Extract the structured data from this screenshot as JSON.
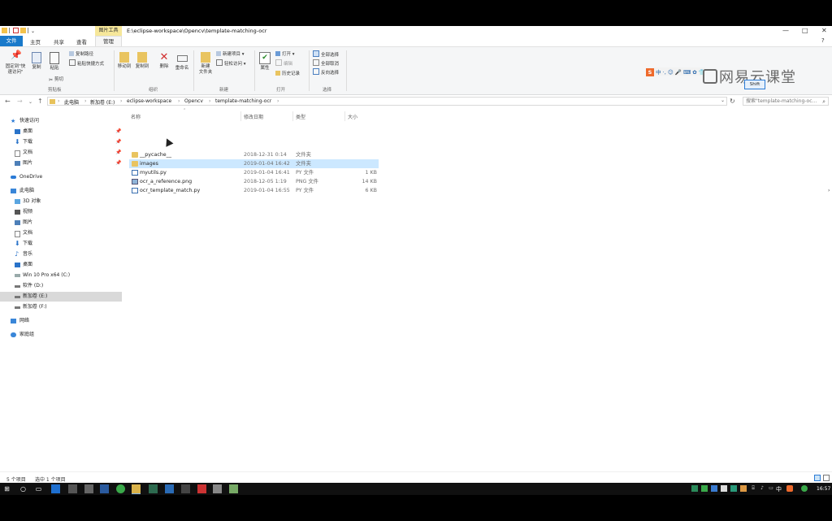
{
  "window": {
    "title": "E:\\eclipse-workspace\\Opencv\\template-matching-ocr",
    "context_tab": "图片工具",
    "minimize": "—",
    "maximize": "□",
    "close": "✕"
  },
  "ribbon_tabs": {
    "file": "文件",
    "home": "主页",
    "share": "共享",
    "view": "查看",
    "manage": "管理",
    "help": "?"
  },
  "ribbon": {
    "pin_quick": "固定到\"快\n速访问\"",
    "copy": "复制",
    "paste": "粘贴",
    "copy_path": "复制路径",
    "paste_shortcut": "粘贴快捷方式",
    "cut": "剪切",
    "group_clipboard": "剪贴板",
    "move_to": "移动到",
    "copy_to": "复制到",
    "delete": "删除",
    "rename": "重命名",
    "group_organize": "组织",
    "new_folder": "新建\n文件夹",
    "new_item": "新建项目 ▾",
    "easy_access": "轻松访问 ▾",
    "group_new": "新建",
    "properties": "属性",
    "open": "打开 ▾",
    "edit": "编辑",
    "history": "历史记录",
    "group_open": "打开",
    "select_all": "全部选择",
    "select_none": "全部取消",
    "invert_selection": "反向选择",
    "group_select": "选择"
  },
  "overlay": {
    "ime_s": "S",
    "ime_items": "中 ·, ☺ 🎤 ⌨ ✿ 👕",
    "watermark": "网易云课堂",
    "tooltip": "Shift"
  },
  "address": {
    "crumbs": [
      "此电脑",
      "新加卷 (E:)",
      "eclipse-workspace",
      "Opencv",
      "template-matching-ocr"
    ],
    "search_placeholder": "搜索\"template-matching-oc...",
    "back": "←",
    "forward": "→",
    "recent": "⌄",
    "up": "↑",
    "dropdown": "⌄",
    "refresh": "↻"
  },
  "nav_pane": {
    "quick_access": "快速访问",
    "qa_items": [
      "桌面",
      "下载",
      "文档",
      "图片"
    ],
    "onedrive": "OneDrive",
    "this_pc": "此电脑",
    "pc_items": [
      "3D 对象",
      "视频",
      "图片",
      "文档",
      "下载",
      "音乐",
      "桌面",
      "Win 10 Pro x64 (C:)",
      "软件 (D:)",
      "新加卷 (E:)",
      "新加卷 (F:)"
    ],
    "network": "网络",
    "homegroup": "家庭组"
  },
  "columns": {
    "name": "名称",
    "date": "修改日期",
    "type": "类型",
    "size": "大小"
  },
  "files": [
    {
      "name": "__pycache__",
      "date": "2018-12-31 0:14",
      "type": "文件夹",
      "size": "",
      "icon": "folder"
    },
    {
      "name": "images",
      "date": "2019-01-04 16:42",
      "type": "文件夹",
      "size": "",
      "icon": "folder"
    },
    {
      "name": "myutils.py",
      "date": "2019-01-04 16:41",
      "type": "PY 文件",
      "size": "1 KB",
      "icon": "py"
    },
    {
      "name": "ocr_a_reference.png",
      "date": "2018-12-05 1:19",
      "type": "PNG 文件",
      "size": "14 KB",
      "icon": "png"
    },
    {
      "name": "ocr_template_match.py",
      "date": "2019-01-04 16:55",
      "type": "PY 文件",
      "size": "6 KB",
      "icon": "py"
    }
  ],
  "status": {
    "count": "5 个项目",
    "selected": "选中 1 个项目"
  },
  "taskbar": {
    "start": "⊞",
    "search": "○",
    "taskview": "▭",
    "ime": "中",
    "time": "16:57"
  },
  "colors": {
    "accent": "#1979ca",
    "selection": "#cce8ff",
    "folder": "#e9c460",
    "context_tab": "#f6e79a"
  }
}
